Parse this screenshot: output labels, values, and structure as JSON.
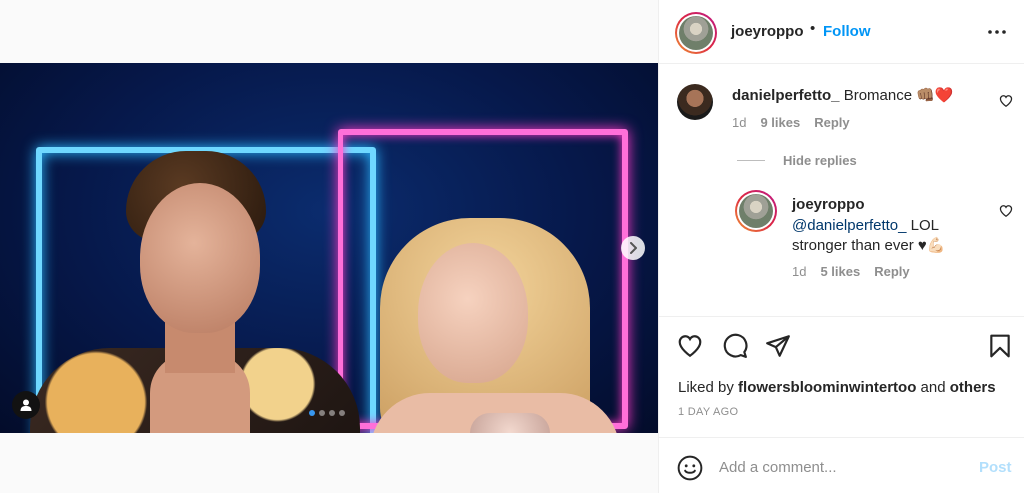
{
  "post": {
    "author": "joeyroppo",
    "separator": "•",
    "follow_label": "Follow",
    "more_icon": "more-horizontal-icon",
    "carousel": {
      "total_slides": 4,
      "active_slide": 1
    }
  },
  "comments": [
    {
      "user": "danielperfetto_",
      "text": "Bromance 👊🏽❤️",
      "time": "1d",
      "likes": "9 likes",
      "reply_label": "Reply"
    }
  ],
  "hide_replies_label": "Hide replies",
  "replies": [
    {
      "user": "joeyroppo",
      "mention": "@danielperfetto_",
      "text": " LOL stronger than ever ♥💪🏻",
      "time": "1d",
      "likes": "5 likes",
      "reply_label": "Reply"
    }
  ],
  "actions": {
    "liked_by_prefix": "Liked by ",
    "liked_by_user": "flowersbloominwintertoo",
    "liked_by_and": " and ",
    "liked_by_others": "others",
    "time_ago": "1 DAY AGO"
  },
  "add_comment": {
    "placeholder": "Add a comment...",
    "post_label": "Post"
  },
  "colors": {
    "accent": "#0095f6",
    "post_disabled": "#b2dffc",
    "muted": "#8e8e8e",
    "text": "#262626"
  }
}
